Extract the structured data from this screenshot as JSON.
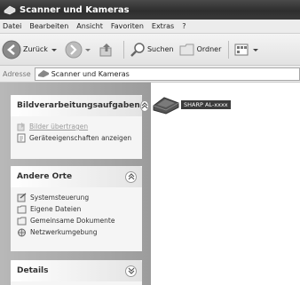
{
  "window": {
    "title": "Scanner und Kameras"
  },
  "menubar": {
    "items": [
      "Datei",
      "Bearbeiten",
      "Ansicht",
      "Favoriten",
      "Extras",
      "?"
    ]
  },
  "toolbar": {
    "back": "Zurück",
    "search": "Suchen",
    "folders": "Ordner"
  },
  "addressbar": {
    "label": "Adresse",
    "value": "Scanner und Kameras"
  },
  "sidebar": {
    "image_tasks": {
      "title": "Bildverarbeitungsaufgaben",
      "items": [
        "Bilder übertragen",
        "Geräteeigenschaften anzeigen"
      ]
    },
    "other_places": {
      "title": "Andere Orte",
      "items": [
        "Systemsteuerung",
        "Eigene Dateien",
        "Gemeinsame Dokumente",
        "Netzwerkumgebung"
      ]
    },
    "details": {
      "title": "Details"
    }
  },
  "content": {
    "devices": [
      {
        "label": "SHARP AL-xxxx",
        "icon": "scanner-icon"
      }
    ]
  }
}
